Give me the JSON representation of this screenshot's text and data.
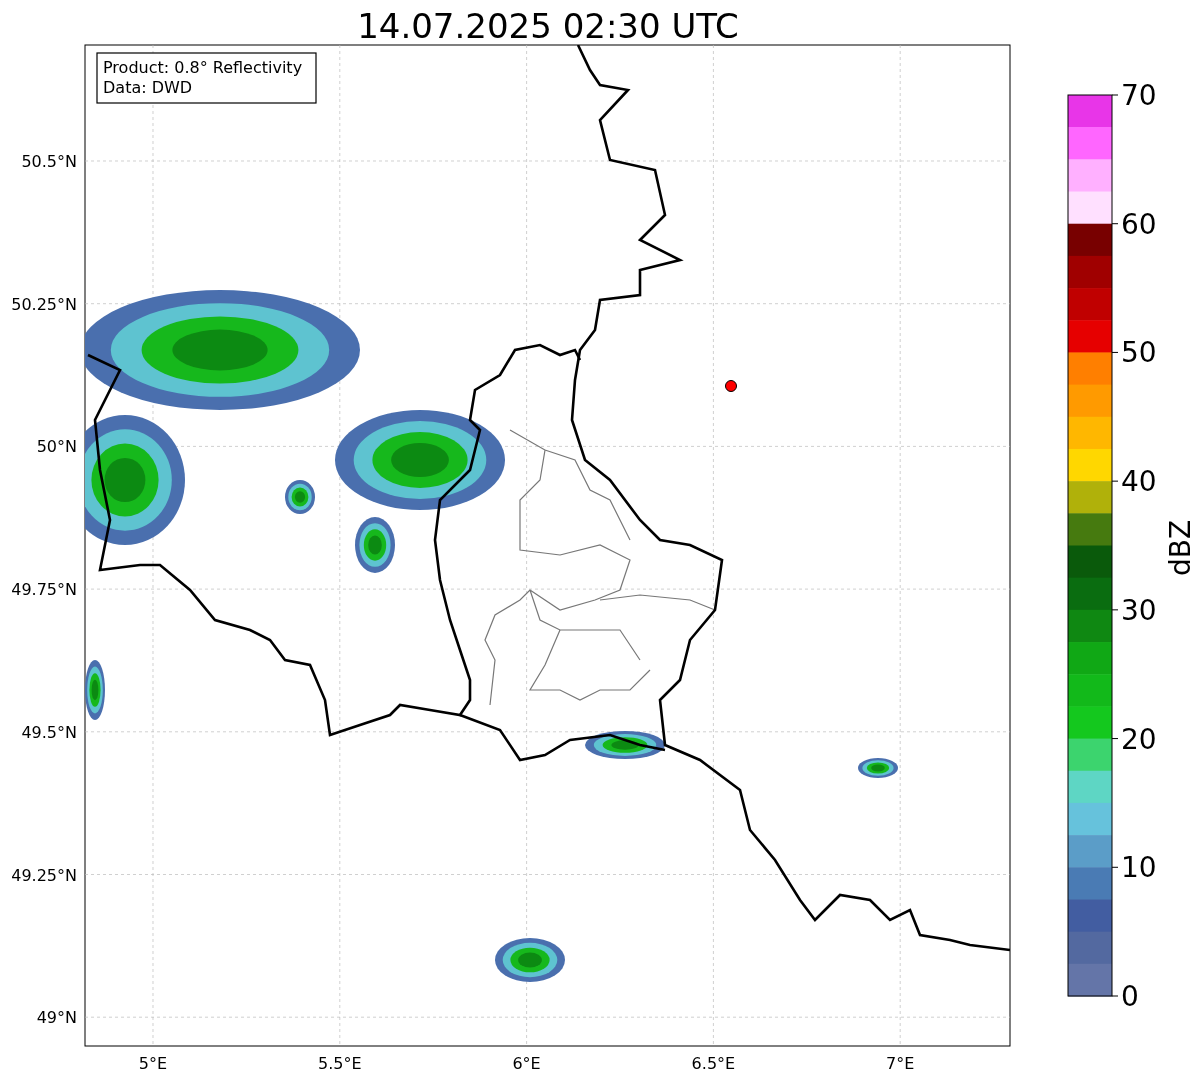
{
  "title": "14.07.2025 02:30 UTC",
  "info_box": [
    "Product: 0.8° Reflectivity",
    "Data: DWD"
  ],
  "map": {
    "lat_ticks": [
      "50.5°N",
      "50.25°N",
      "50°N",
      "49.75°N",
      "49.5°N",
      "49.25°N",
      "49°N"
    ],
    "lon_ticks": [
      "5°E",
      "5.5°E",
      "6°E",
      "6.5°E",
      "7°E"
    ]
  },
  "colorbar": {
    "label": "dBZ",
    "ticks": [
      "70",
      "60",
      "50",
      "40",
      "30",
      "20",
      "10",
      "0"
    ],
    "bands": [
      {
        "color": "#e835e8"
      },
      {
        "color": "#ff66ff"
      },
      {
        "color": "#ffb0ff"
      },
      {
        "color": "#ffe0ff"
      },
      {
        "color": "#780000"
      },
      {
        "color": "#a00000"
      },
      {
        "color": "#c00000"
      },
      {
        "color": "#e60000"
      },
      {
        "color": "#ff7f00"
      },
      {
        "color": "#ff9a00"
      },
      {
        "color": "#ffb700"
      },
      {
        "color": "#ffd700"
      },
      {
        "color": "#b0b10a"
      },
      {
        "color": "#467a0f"
      },
      {
        "color": "#0a5a0b"
      },
      {
        "color": "#0a6d10"
      },
      {
        "color": "#0f8812"
      },
      {
        "color": "#10a815"
      },
      {
        "color": "#12b91a"
      },
      {
        "color": "#14c81e"
      },
      {
        "color": "#3cd46e"
      },
      {
        "color": "#5ed6c4"
      },
      {
        "color": "#66c2dc"
      },
      {
        "color": "#5b9dc8"
      },
      {
        "color": "#4a7bb4"
      },
      {
        "color": "#425da1"
      },
      {
        "color": "#5369a0"
      },
      {
        "color": "#6475a8"
      }
    ]
  }
}
